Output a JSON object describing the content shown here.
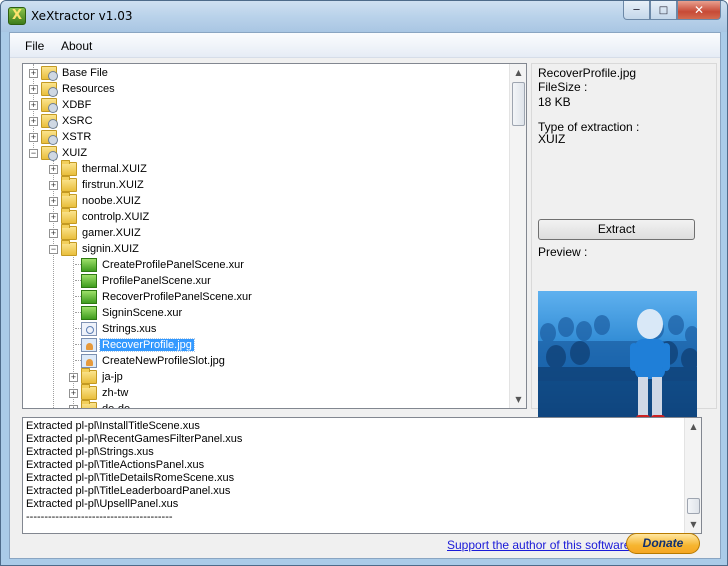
{
  "window": {
    "title": "XeXtractor v1.03",
    "min_glyph": "─",
    "max_glyph": "□",
    "close_glyph": "✕",
    "app_icon_letter": "X"
  },
  "menu": {
    "items": [
      {
        "label": "File"
      },
      {
        "label": "About"
      }
    ]
  },
  "tree": {
    "items": [
      {
        "label": "Base File",
        "icon": "gear-folder-icon",
        "expander": "+",
        "level": 0
      },
      {
        "label": "Resources",
        "icon": "gear-folder-icon",
        "expander": "+",
        "level": 0
      },
      {
        "label": "XDBF",
        "icon": "gear-folder-icon",
        "expander": "+",
        "level": 0
      },
      {
        "label": "XSRC",
        "icon": "gear-folder-icon",
        "expander": "+",
        "level": 0
      },
      {
        "label": "XSTR",
        "icon": "gear-folder-icon",
        "expander": "+",
        "level": 0
      },
      {
        "label": "XUIZ",
        "icon": "gear-folder-icon",
        "expander": "−",
        "level": 0
      },
      {
        "label": "thermal.XUIZ",
        "icon": "folder-icon",
        "expander": "+",
        "level": 1
      },
      {
        "label": "firstrun.XUIZ",
        "icon": "folder-icon",
        "expander": "+",
        "level": 1
      },
      {
        "label": "noobe.XUIZ",
        "icon": "folder-icon",
        "expander": "+",
        "level": 1
      },
      {
        "label": "controlp.XUIZ",
        "icon": "folder-icon",
        "expander": "+",
        "level": 1
      },
      {
        "label": "gamer.XUIZ",
        "icon": "folder-icon",
        "expander": "+",
        "level": 1
      },
      {
        "label": "signin.XUIZ",
        "icon": "folder-icon",
        "expander": "−",
        "level": 1
      },
      {
        "label": "CreateProfilePanelScene.xur",
        "icon": "xur-file-icon",
        "expander": "",
        "level": 2
      },
      {
        "label": "ProfilePanelScene.xur",
        "icon": "xur-file-icon",
        "expander": "",
        "level": 2
      },
      {
        "label": "RecoverProfilePanelScene.xur",
        "icon": "xur-file-icon",
        "expander": "",
        "level": 2
      },
      {
        "label": "SigninScene.xur",
        "icon": "xur-file-icon",
        "expander": "",
        "level": 2
      },
      {
        "label": "Strings.xus",
        "icon": "xus-file-icon",
        "expander": "",
        "level": 2
      },
      {
        "label": "RecoverProfile.jpg",
        "icon": "jpg-file-icon",
        "expander": "",
        "level": 2,
        "selected": true
      },
      {
        "label": "CreateNewProfileSlot.jpg",
        "icon": "jpg-file-icon",
        "expander": "",
        "level": 2
      },
      {
        "label": "ja-jp",
        "icon": "folder-icon",
        "expander": "+",
        "level": 2
      },
      {
        "label": "zh-tw",
        "icon": "folder-icon",
        "expander": "+",
        "level": 2
      },
      {
        "label": "de-de",
        "icon": "folder-icon",
        "expander": "+",
        "level": 2
      }
    ]
  },
  "info": {
    "file_name": "RecoverProfile.jpg",
    "filesize_label": "FileSize :",
    "filesize_value": "18 KB",
    "type_label": "Type of extraction :",
    "type_value": "XUIZ",
    "extract_button": "Extract",
    "preview_label": "Preview :"
  },
  "log": {
    "lines": [
      "Extracted pl-pl\\InstallTitleScene.xus",
      "Extracted pl-pl\\RecentGamesFilterPanel.xus",
      "Extracted pl-pl\\Strings.xus",
      "Extracted pl-pl\\TitleActionsPanel.xus",
      "Extracted pl-pl\\TitleDetailsRomeScene.xus",
      "Extracted pl-pl\\TitleLeaderboardPanel.xus",
      "Extracted pl-pl\\UpsellPanel.xus",
      "----------------------------------------"
    ]
  },
  "footer": {
    "support_link": "Support the author of this software :",
    "donate_button": "Donate"
  },
  "colors": {
    "selection": "#3399ff",
    "link": "#1a1ad8",
    "donate": "#f6b530"
  }
}
